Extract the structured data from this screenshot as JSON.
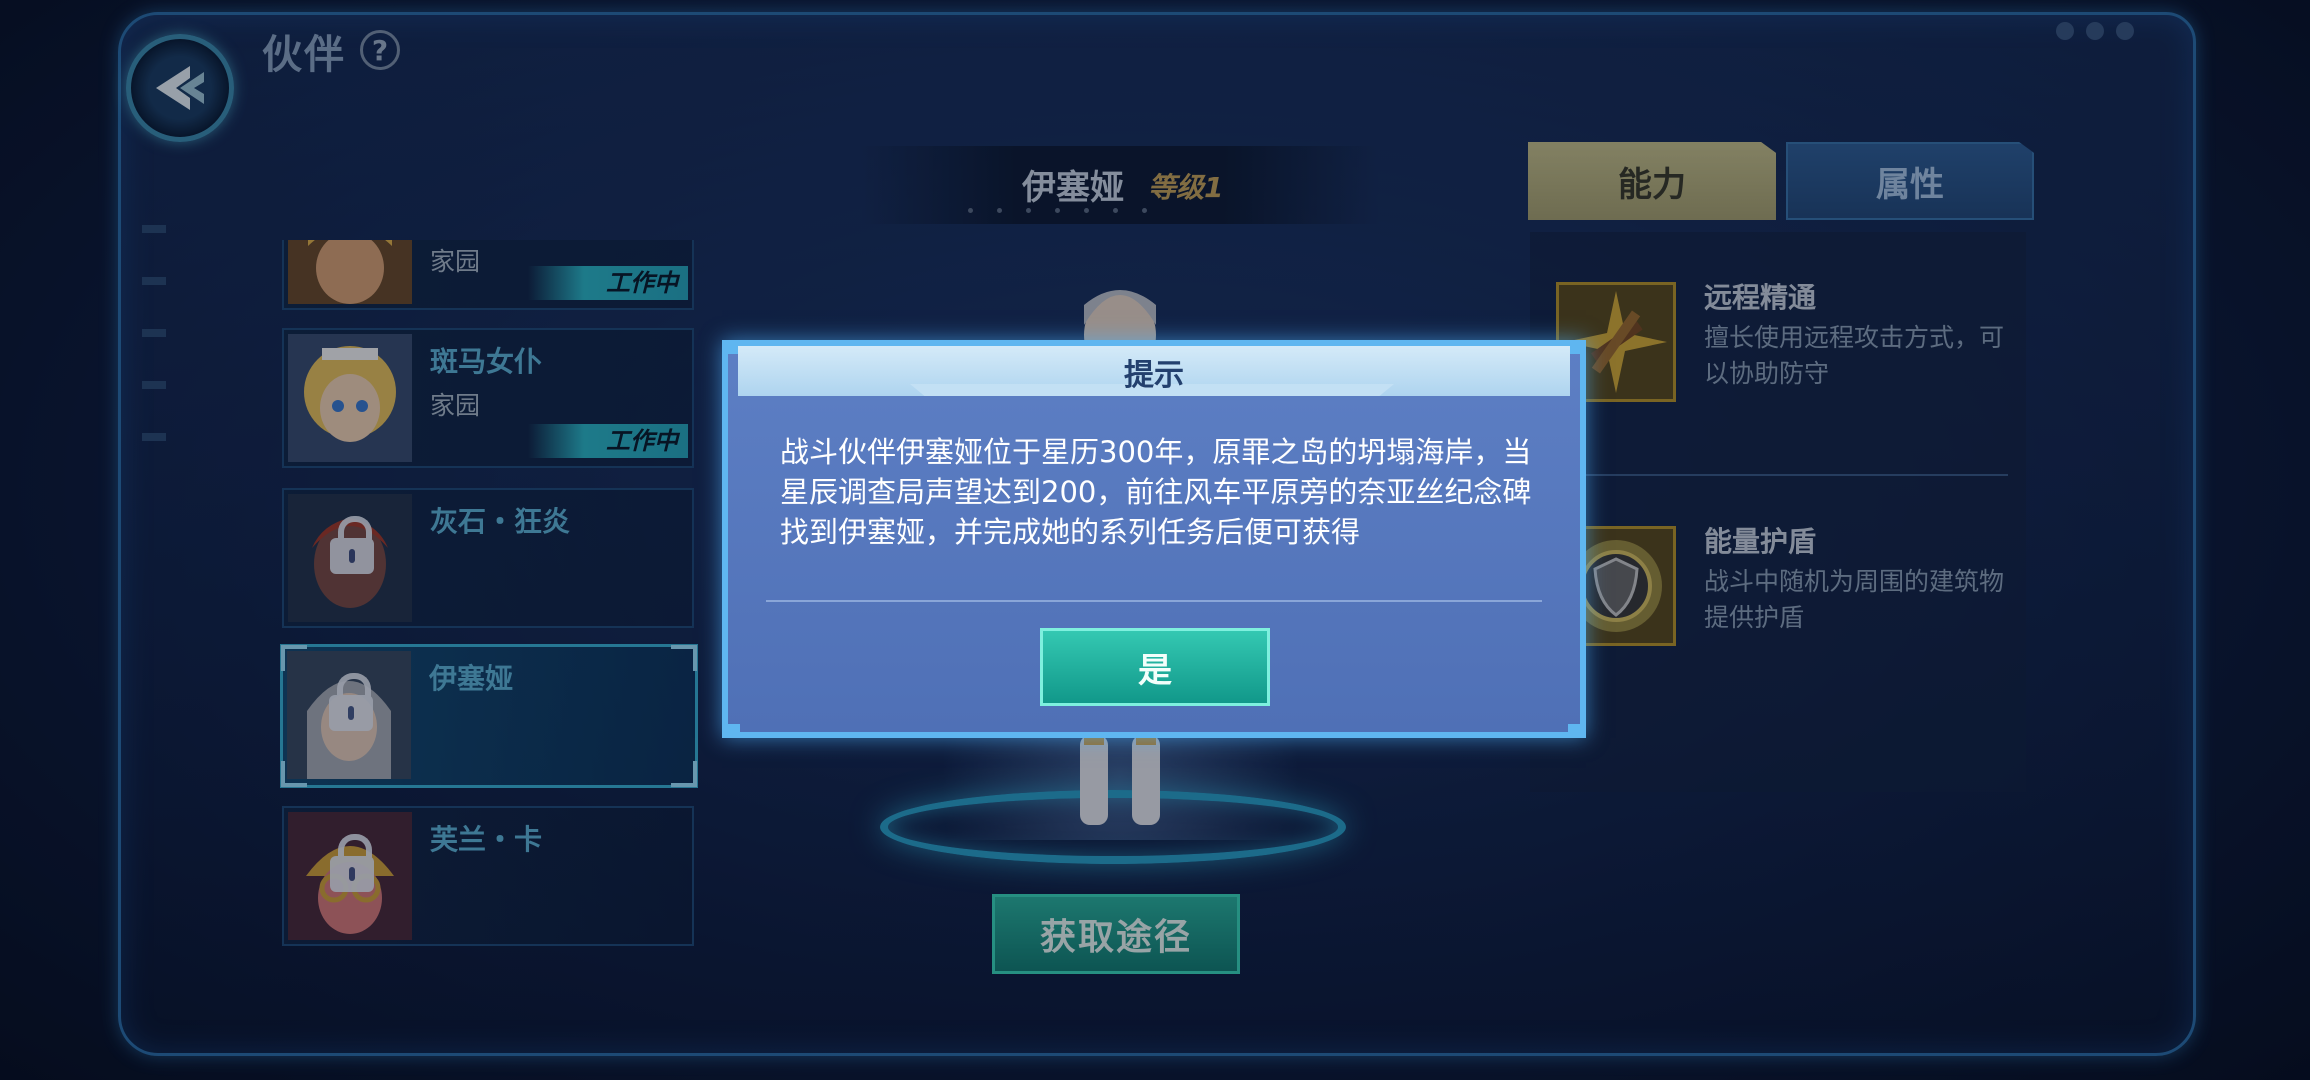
{
  "header": {
    "title": "伙伴",
    "help_label": "?"
  },
  "partners": [
    {
      "name": "",
      "location": "家园",
      "status": "工作中",
      "locked": false
    },
    {
      "name": "斑马女仆",
      "location": "家园",
      "status": "工作中",
      "locked": false
    },
    {
      "name": "灰石・狂炎",
      "location": "",
      "status": "",
      "locked": true
    },
    {
      "name": "伊塞娅",
      "location": "",
      "status": "",
      "locked": true,
      "selected": true
    },
    {
      "name": "芙兰・卡",
      "location": "",
      "status": "",
      "locked": true
    }
  ],
  "character": {
    "name": "伊塞娅",
    "level": "等级1"
  },
  "source_button": "获取途径",
  "tabs": {
    "ability": "能力",
    "attributes": "属性",
    "active": "能力"
  },
  "skills": [
    {
      "title": "远程精通",
      "desc": "擅长使用远程攻击方式，可以协助防守",
      "icon": "crossbow-icon"
    },
    {
      "title": "能量护盾",
      "desc": "战斗中随机为周围的建筑物提供护盾",
      "icon": "shield-icon"
    }
  ],
  "dialog": {
    "title": "提示",
    "message": "战斗伙伴伊塞娅位于星历300年，原罪之岛的坍塌海岸，当星辰调查局声望达到200，前往风车平原旁的奈亚丝纪念碑找到伊塞娅，并完成她的系列任务后便可获得",
    "confirm_label": "是"
  },
  "colors": {
    "accent": "#2aa0c8",
    "confirm": "#1faa98",
    "tab_active": "#c8c28c"
  }
}
